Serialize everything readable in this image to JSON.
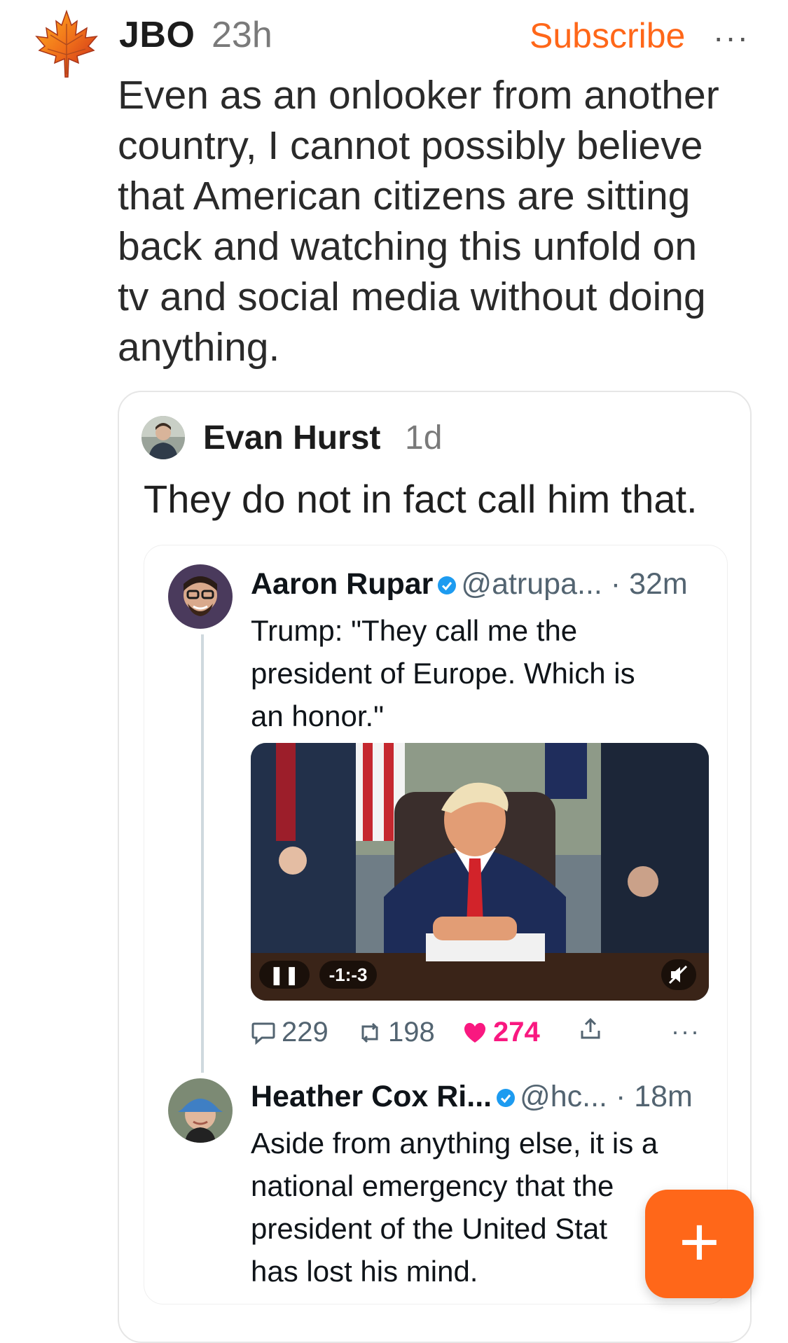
{
  "post": {
    "author": "JBO",
    "time": "23h",
    "subscribe_label": "Subscribe",
    "more_label": "···",
    "body_lines": [
      "Even as an onlooker from another",
      "country, I cannot possibly believe",
      "that American citizens are sitting",
      "back and watching this unfold on",
      "tv and social media without doing",
      "anything."
    ]
  },
  "quote": {
    "author": "Evan Hurst",
    "time": "1d",
    "text": "They do not in fact call him that."
  },
  "tweet1": {
    "name": "Aaron Rupar",
    "handle": "@atrupa...",
    "time": "· 32m",
    "lines": [
      "Trump: \"They call me the",
      "president of Europe. Which is",
      "an honor.\""
    ],
    "video_timer": "-1:-3",
    "reply_count": "229",
    "retweet_count": "198",
    "like_count": "274",
    "more_label": "···"
  },
  "tweet2": {
    "name": "Heather Cox Ri...",
    "handle": "@hc...",
    "time": "· 18m",
    "lines": [
      "Aside from anything else, it is a",
      "national emergency that the",
      "president of the United Stat",
      "has lost his mind."
    ]
  },
  "fab": {
    "label": "+"
  },
  "colors": {
    "accent": "#ff6719",
    "verified": "#1d9bf0",
    "like": "#f91880",
    "muted": "#7a7a7a"
  },
  "icons": {
    "maple": "maple-leaf-icon",
    "verified": "verified-badge-icon",
    "reply": "reply-icon",
    "retweet": "retweet-icon",
    "like": "heart-icon",
    "share": "share-icon",
    "pause": "pause-icon",
    "mute": "mute-icon",
    "plus": "plus-icon"
  }
}
